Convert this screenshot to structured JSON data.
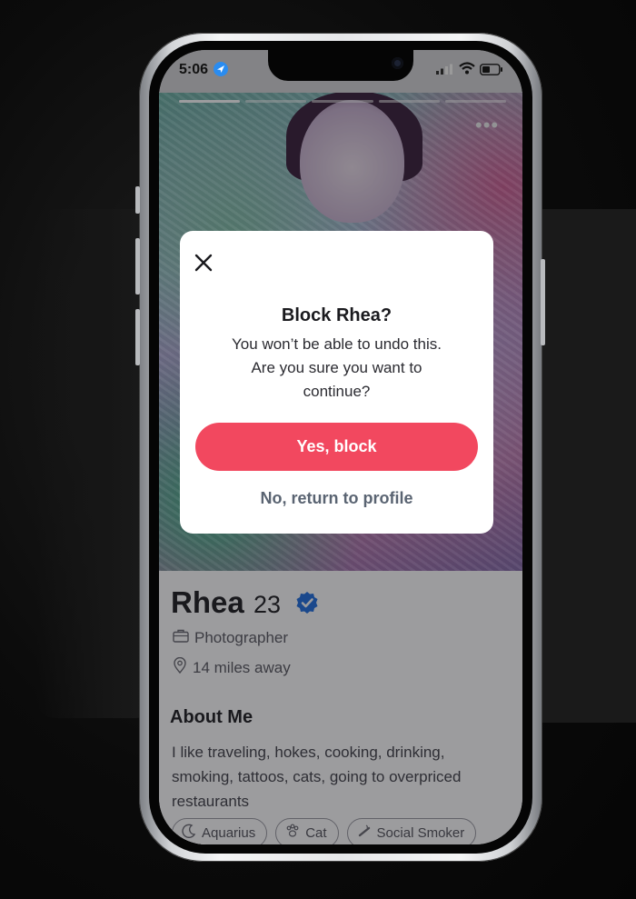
{
  "status_bar": {
    "time": "5:06",
    "icons": [
      "location-arrow-icon",
      "signal-icon",
      "wifi-icon",
      "battery-icon"
    ]
  },
  "photo": {
    "story_bars_total": 5,
    "story_bar_active": 1,
    "more_icon": "more-dots-icon"
  },
  "dialog": {
    "close_icon": "close-icon",
    "title": "Block Rhea?",
    "body_line1": "You won’t be able to undo this.",
    "body_line2": "Are you sure you want to",
    "body_line3": "continue?",
    "confirm_label": "Yes, block",
    "cancel_label": "No, return to profile",
    "confirm_color": "#f2485f"
  },
  "profile": {
    "name": "Rhea",
    "age": "23",
    "verified": true,
    "job": "Photographer",
    "distance": "14 miles away",
    "about_title": "About Me",
    "about_line1": "I like traveling, hokes, cooking, drinking,",
    "about_line2": "smoking, tattoos, cats, going to overpriced",
    "about_line3": "restaurants",
    "chips": [
      {
        "label": "Aquarius",
        "icon": "moon-icon"
      },
      {
        "label": "Cat",
        "icon": "paw-icon"
      },
      {
        "label": "Social Smoker",
        "icon": "cigarette-icon"
      }
    ]
  }
}
